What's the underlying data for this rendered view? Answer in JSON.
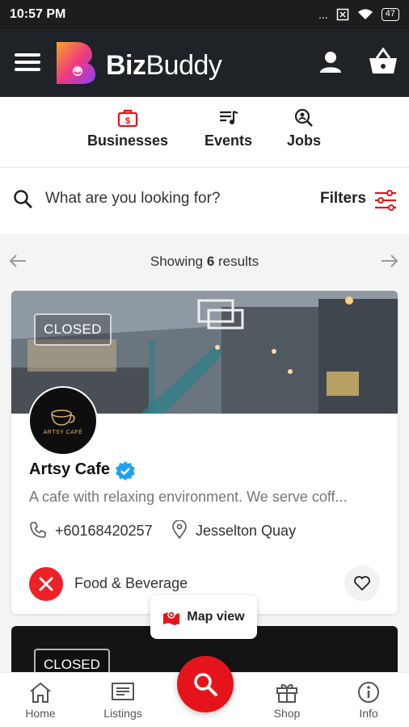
{
  "status_bar": {
    "time": "10:57 PM",
    "signal": "...",
    "battery": "47"
  },
  "header": {
    "brand_bold": "Biz",
    "brand_rest": "Buddy"
  },
  "tabs": [
    {
      "label": "Businesses",
      "icon": "briefcase-icon",
      "active": true
    },
    {
      "label": "Events",
      "icon": "music-list-icon",
      "active": false
    },
    {
      "label": "Jobs",
      "icon": "job-search-icon",
      "active": false
    }
  ],
  "search": {
    "placeholder": "What are you looking for?",
    "filters_label": "Filters"
  },
  "results": {
    "prefix": "Showing ",
    "count": "6",
    "suffix": " results"
  },
  "listing": {
    "status": "CLOSED",
    "name": "Artsy Cafe",
    "logo_text": "ARTSY CAFÉ",
    "description": "A cafe with relaxing environment. We serve coff...",
    "phone": "+60168420257",
    "location": "Jesselton Quay",
    "category": "Food & Beverage"
  },
  "listing2": {
    "status": "CLOSED"
  },
  "map_view": {
    "label": "Map view"
  },
  "bottom_nav": {
    "home": "Home",
    "listings": "Listings",
    "shop": "Shop",
    "info": "Info"
  },
  "colors": {
    "accent": "#e5141a",
    "header_bg": "#1f2226",
    "verified": "#1da1f2"
  }
}
